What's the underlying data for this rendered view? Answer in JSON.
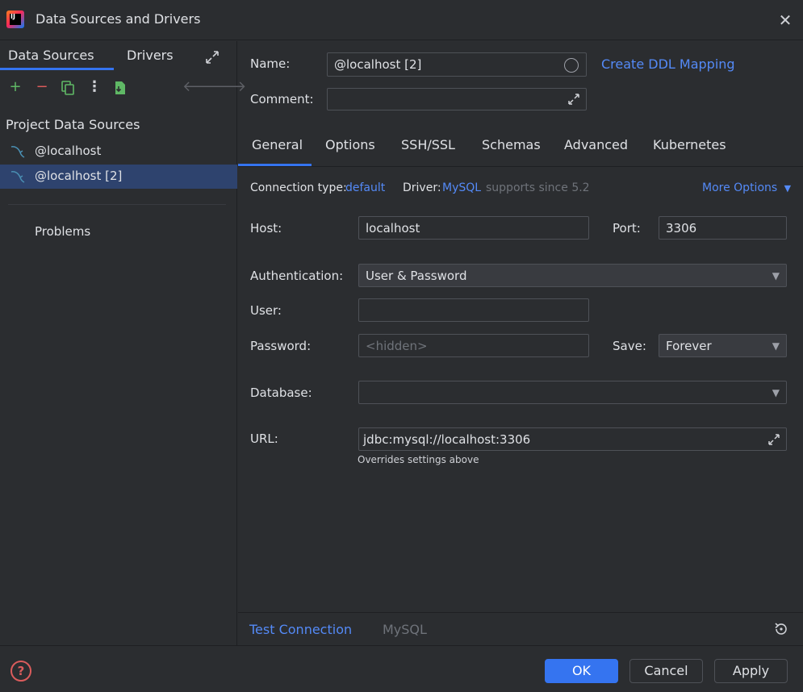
{
  "window": {
    "title": "Data Sources and Drivers"
  },
  "left": {
    "tabs": [
      {
        "label": "Data Sources"
      },
      {
        "label": "Drivers"
      }
    ],
    "section_title": "Project Data Sources",
    "items": [
      {
        "label": "@localhost"
      },
      {
        "label": "@localhost [2]",
        "selected": true
      }
    ],
    "problems_label": "Problems"
  },
  "form": {
    "name_label": "Name:",
    "name_value": "@localhost [2]",
    "ddl_link": "Create DDL Mapping",
    "comment_label": "Comment:",
    "comment_value": ""
  },
  "tabs": [
    {
      "label": "General",
      "active": true
    },
    {
      "label": "Options"
    },
    {
      "label": "SSH/SSL"
    },
    {
      "label": "Schemas"
    },
    {
      "label": "Advanced"
    },
    {
      "label": "Kubernetes"
    }
  ],
  "general": {
    "connection_type_label": "Connection type:",
    "connection_type_value": "default",
    "driver_label": "Driver:",
    "driver_value": "MySQL",
    "driver_note": "supports since 5.2",
    "more_options": "More Options",
    "host_label": "Host:",
    "host_value": "localhost",
    "port_label": "Port:",
    "port_value": "3306",
    "auth_label": "Authentication:",
    "auth_value": "User & Password",
    "user_label": "User:",
    "user_value": "",
    "password_label": "Password:",
    "password_placeholder": "<hidden>",
    "save_label": "Save:",
    "save_value": "Forever",
    "database_label": "Database:",
    "database_value": "",
    "url_label": "URL:",
    "url_value": "jdbc:mysql://localhost:3306",
    "url_hint": "Overrides settings above"
  },
  "test_bar": {
    "test_connection": "Test Connection",
    "driver_name": "MySQL"
  },
  "footer": {
    "ok": "OK",
    "cancel": "Cancel",
    "apply": "Apply",
    "help": "?"
  },
  "colors": {
    "accent": "#3574f0",
    "link": "#548af7",
    "background": "#2b2d30",
    "selection": "#2e436e"
  }
}
